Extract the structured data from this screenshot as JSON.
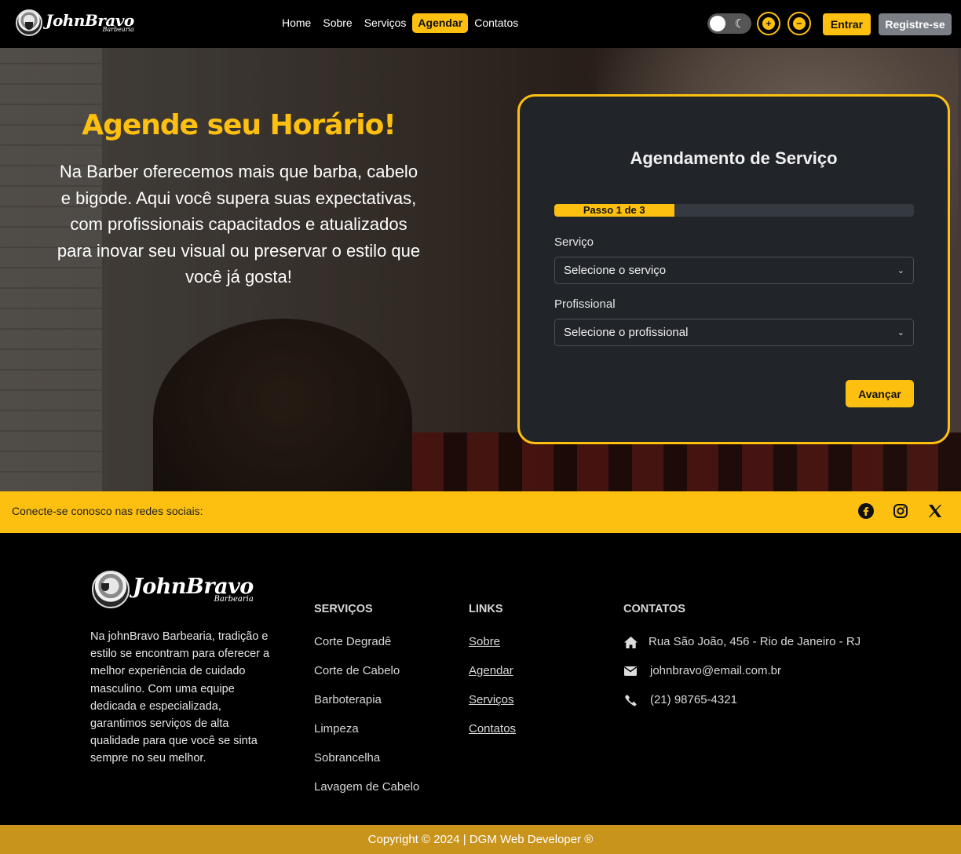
{
  "brand": {
    "name": "JohnBravo",
    "sub": "Barbearia"
  },
  "nav": {
    "links": [
      "Home",
      "Sobre",
      "Serviços",
      "Agendar",
      "Contatos"
    ],
    "active_index": 3,
    "login_label": "Entrar",
    "register_label": "Registre-se",
    "theme_icon": "moon-icon",
    "zoom_in_icon": "zoom-in-icon",
    "zoom_out_icon": "zoom-out-icon"
  },
  "hero": {
    "title": "Agende seu Horário!",
    "text": "Na Barber oferecemos mais que barba, cabelo e bigode. Aqui você supera suas expectativas, com profissionais capacitados e atualizados para inovar seu visual ou preservar o estilo que você já gosta!"
  },
  "booking": {
    "title": "Agendamento de Serviço",
    "progress_label": "Passo 1 de 3",
    "progress_fraction": 0.333,
    "service_label": "Serviço",
    "service_value": "Selecione o serviço",
    "professional_label": "Profissional",
    "professional_value": "Selecione o profissional",
    "next_label": "Avançar"
  },
  "social": {
    "text": "Conecte-se conosco nas redes sociais:",
    "icons": [
      "facebook-icon",
      "instagram-icon",
      "x-icon"
    ]
  },
  "footer": {
    "about": "Na johnBravo Barbearia, tradição e estilo se encontram para oferecer a melhor experiência de cuidado masculino. Com uma equipe dedicada e especializada, garantimos serviços de alta qualidade para que você se sinta sempre no seu melhor.",
    "services_heading": "SERVIÇOS",
    "services": [
      "Corte Degradê",
      "Corte de Cabelo",
      "Barboterapia",
      "Limpeza",
      "Sobrancelha",
      "Lavagem de Cabelo"
    ],
    "links_heading": "LINKS",
    "links": [
      "Sobre",
      "Agendar",
      "Serviços",
      "Contatos"
    ],
    "contacts_heading": "CONTATOS",
    "contacts": [
      {
        "icon": "home-icon",
        "text": "Rua São João, 456 - Rio de Janeiro - RJ"
      },
      {
        "icon": "envelope-icon",
        "text": "johnbravo@email.com.br"
      },
      {
        "icon": "phone-icon",
        "text": "(21) 98765-4321"
      }
    ]
  },
  "copyright": "Copyright © 2024 | DGM Web Developer ®",
  "colors": {
    "accent": "#fdc010",
    "card_bg": "#212529",
    "footer_bar": "#c9941c"
  }
}
